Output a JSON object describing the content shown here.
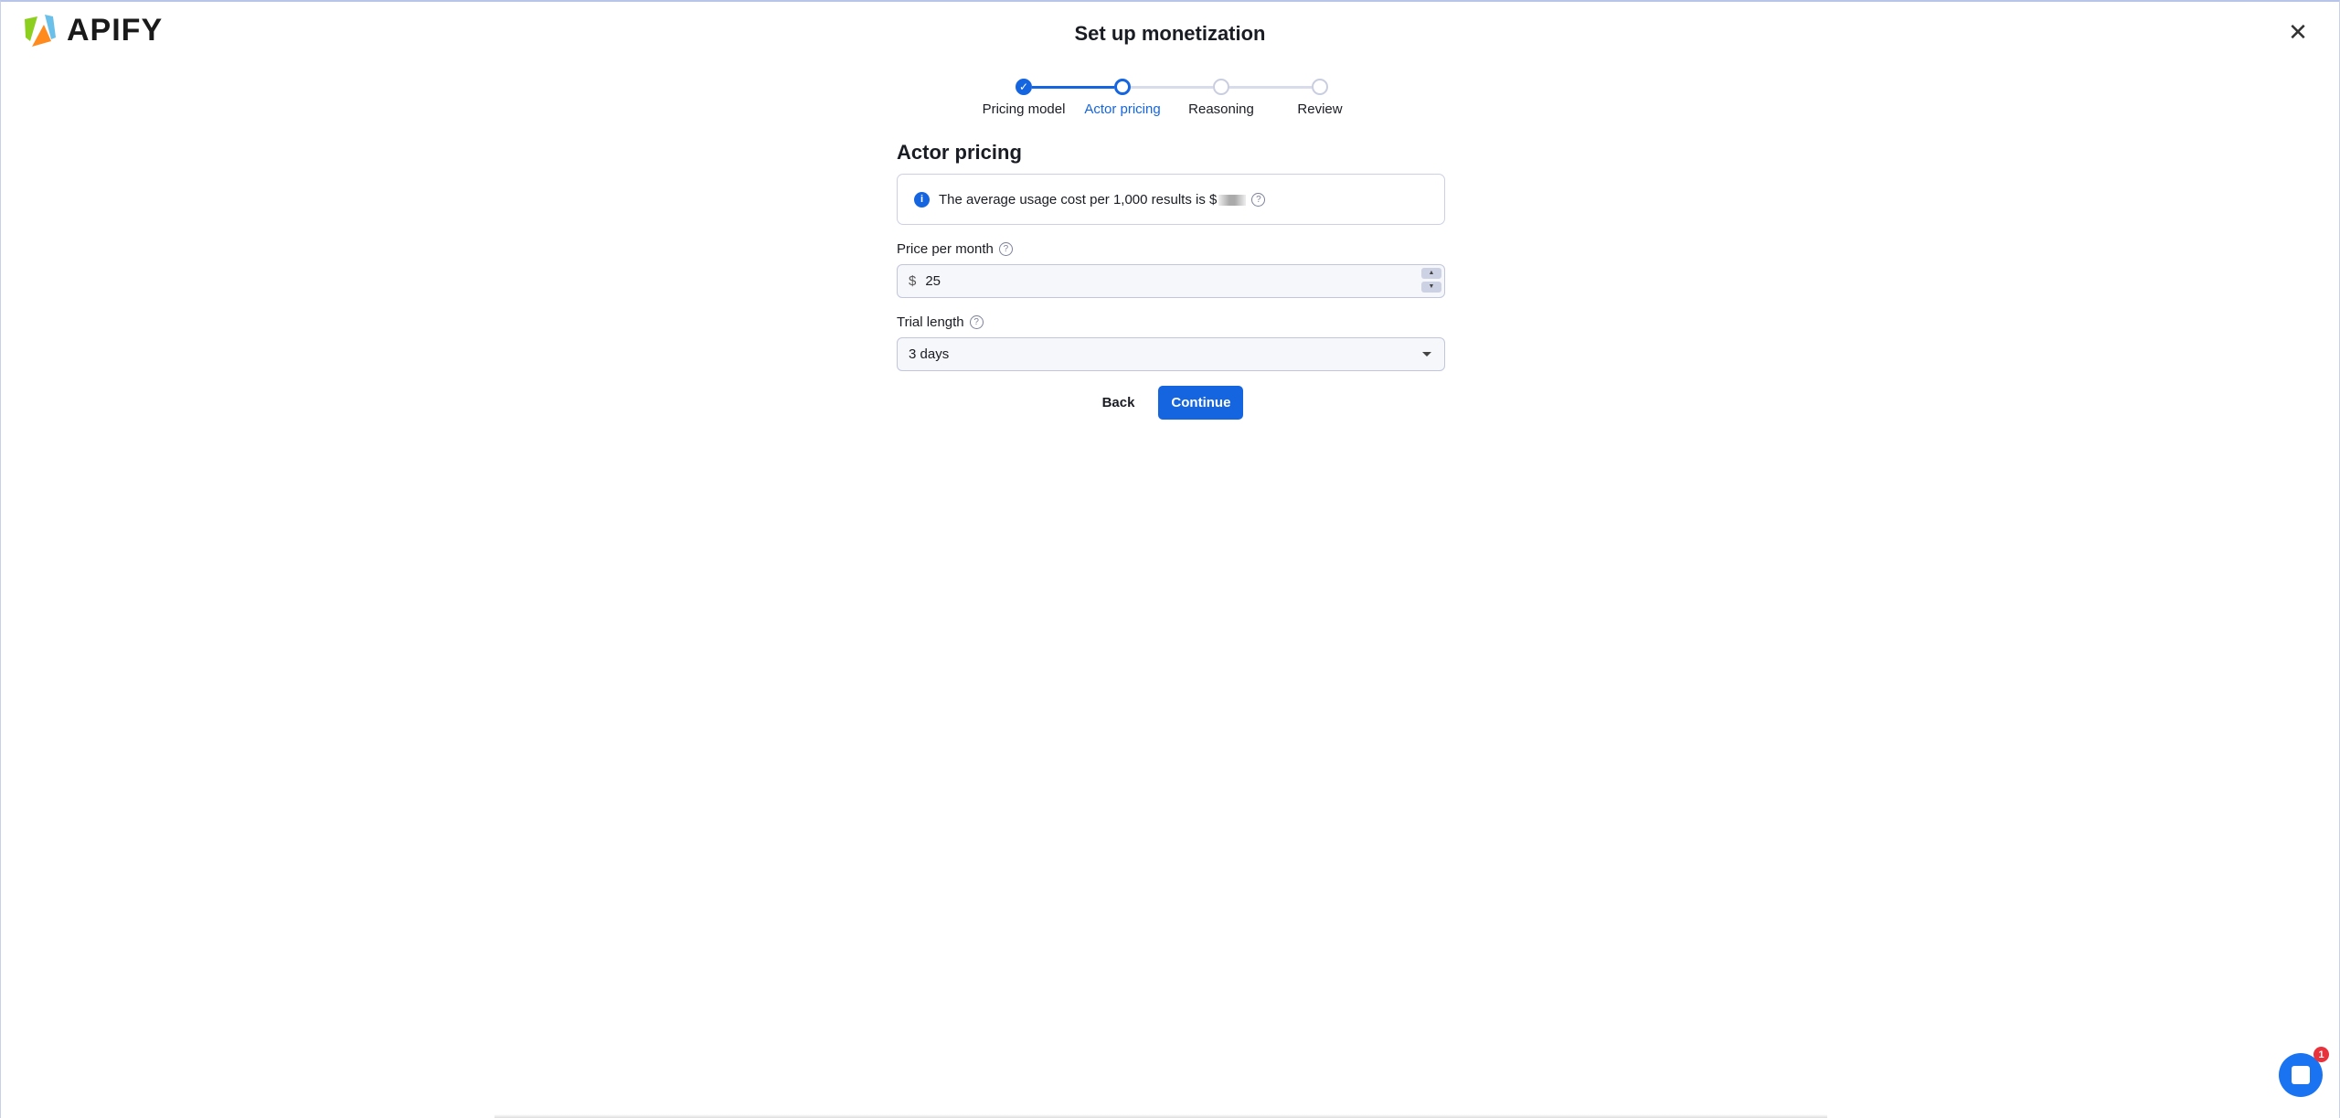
{
  "header": {
    "logo_text": "APIFY",
    "title": "Set up monetization",
    "close_icon": "close-icon"
  },
  "stepper": {
    "steps": [
      {
        "label": "Pricing model",
        "state": "done"
      },
      {
        "label": "Actor pricing",
        "state": "active"
      },
      {
        "label": "Reasoning",
        "state": "pending"
      },
      {
        "label": "Review",
        "state": "pending"
      }
    ]
  },
  "main": {
    "heading": "Actor pricing",
    "info_text": "The average usage cost per 1,000 results is $",
    "price_label": "Price per month",
    "currency": "$",
    "price_value": "25",
    "trial_label": "Trial length",
    "trial_value": "3 days",
    "back_label": "Back",
    "continue_label": "Continue"
  },
  "chat": {
    "badge": "1"
  },
  "colors": {
    "accent": "#1565e0",
    "badge": "#e8323c"
  }
}
